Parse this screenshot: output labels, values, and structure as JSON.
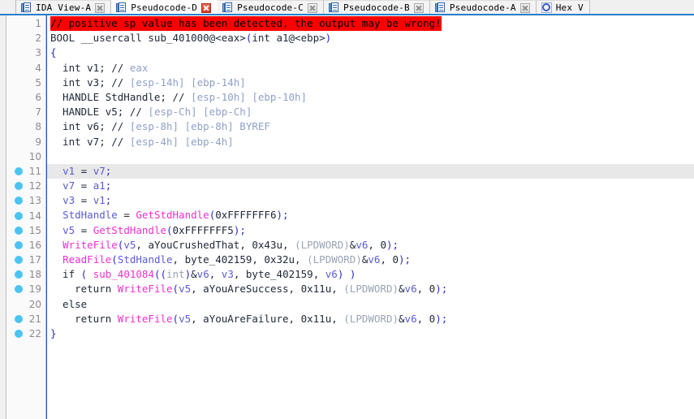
{
  "window": {
    "accent_color": "#2a7fc9",
    "breakpoint_color": "#4cc3f0",
    "warning_bg_color": "#ff0000"
  },
  "tabs": [
    {
      "label": "IDA View-A",
      "icon": "document-icon",
      "active": false,
      "close_icon": "close-icon",
      "close_style": "grey"
    },
    {
      "label": "Pseudocode-D",
      "icon": "document-icon",
      "active": true,
      "close_icon": "close-icon-red",
      "close_style": "red"
    },
    {
      "label": "Pseudocode-C",
      "icon": "document-icon",
      "active": false,
      "close_icon": "close-icon",
      "close_style": "grey"
    },
    {
      "label": "Pseudocode-B",
      "icon": "document-icon",
      "active": false,
      "close_icon": "close-icon",
      "close_style": "grey"
    },
    {
      "label": "Pseudocode-A",
      "icon": "document-icon",
      "active": false,
      "close_icon": "close-icon",
      "close_style": "grey"
    },
    {
      "label": "Hex V",
      "icon": "hex-view-icon",
      "active": false,
      "close_icon": "",
      "close_style": "none"
    }
  ],
  "editor": {
    "current_line": 11,
    "lines": [
      {
        "number": "1",
        "breakpoint": false,
        "current": false,
        "tokens": [
          {
            "text": "// positive sp value has been detected, the output may be wrong!",
            "cls": "t-warn"
          }
        ]
      },
      {
        "number": "2",
        "breakpoint": false,
        "current": false,
        "tokens": [
          {
            "text": "BOOL __usercall sub_401000@<eax>",
            "cls": "t-plain"
          },
          {
            "text": "(",
            "cls": "t-punct"
          },
          {
            "text": "int a1@<ebp>",
            "cls": "t-plain"
          },
          {
            "text": ")",
            "cls": "t-punct"
          }
        ]
      },
      {
        "number": "3",
        "breakpoint": false,
        "current": false,
        "tokens": [
          {
            "text": "{",
            "cls": "t-punct"
          }
        ]
      },
      {
        "number": "4",
        "breakpoint": false,
        "current": false,
        "tokens": [
          {
            "text": "  int v1; ",
            "cls": "t-plain"
          },
          {
            "text": "// ",
            "cls": "t-cmt-dk"
          },
          {
            "text": "eax",
            "cls": "t-cmt"
          }
        ]
      },
      {
        "number": "5",
        "breakpoint": false,
        "current": false,
        "tokens": [
          {
            "text": "  int v3; ",
            "cls": "t-plain"
          },
          {
            "text": "// ",
            "cls": "t-cmt-dk"
          },
          {
            "text": "[esp-14h] [ebp-14h]",
            "cls": "t-cmt"
          }
        ]
      },
      {
        "number": "6",
        "breakpoint": false,
        "current": false,
        "tokens": [
          {
            "text": "  HANDLE StdHandle; ",
            "cls": "t-plain"
          },
          {
            "text": "// ",
            "cls": "t-cmt-dk"
          },
          {
            "text": "[esp-10h] [ebp-10h]",
            "cls": "t-cmt"
          }
        ]
      },
      {
        "number": "7",
        "breakpoint": false,
        "current": false,
        "tokens": [
          {
            "text": "  HANDLE v5; ",
            "cls": "t-plain"
          },
          {
            "text": "// ",
            "cls": "t-cmt-dk"
          },
          {
            "text": "[esp-Ch] [ebp-Ch]",
            "cls": "t-cmt"
          }
        ]
      },
      {
        "number": "8",
        "breakpoint": false,
        "current": false,
        "tokens": [
          {
            "text": "  int v6; ",
            "cls": "t-plain"
          },
          {
            "text": "// ",
            "cls": "t-cmt-dk"
          },
          {
            "text": "[esp-8h] [ebp-8h] BYREF",
            "cls": "t-cmt"
          }
        ]
      },
      {
        "number": "9",
        "breakpoint": false,
        "current": false,
        "tokens": [
          {
            "text": "  int v7; ",
            "cls": "t-plain"
          },
          {
            "text": "// ",
            "cls": "t-cmt-dk"
          },
          {
            "text": "[esp-4h] [ebp-4h]",
            "cls": "t-cmt"
          }
        ]
      },
      {
        "number": "10",
        "breakpoint": false,
        "current": false,
        "tokens": []
      },
      {
        "number": "11",
        "breakpoint": true,
        "current": true,
        "tokens": [
          {
            "text": "  ",
            "cls": "t-plain"
          },
          {
            "text": "v1",
            "cls": "t-var"
          },
          {
            "text": " = ",
            "cls": "t-plain"
          },
          {
            "text": "v7",
            "cls": "t-var"
          },
          {
            "text": ";",
            "cls": "t-punct"
          }
        ]
      },
      {
        "number": "12",
        "breakpoint": true,
        "current": false,
        "tokens": [
          {
            "text": "  ",
            "cls": "t-plain"
          },
          {
            "text": "v7",
            "cls": "t-var"
          },
          {
            "text": " = ",
            "cls": "t-plain"
          },
          {
            "text": "a1",
            "cls": "t-var"
          },
          {
            "text": ";",
            "cls": "t-punct"
          }
        ]
      },
      {
        "number": "13",
        "breakpoint": true,
        "current": false,
        "tokens": [
          {
            "text": "  ",
            "cls": "t-plain"
          },
          {
            "text": "v3",
            "cls": "t-var"
          },
          {
            "text": " = ",
            "cls": "t-plain"
          },
          {
            "text": "v1",
            "cls": "t-var"
          },
          {
            "text": ";",
            "cls": "t-punct"
          }
        ]
      },
      {
        "number": "14",
        "breakpoint": true,
        "current": false,
        "tokens": [
          {
            "text": "  ",
            "cls": "t-plain"
          },
          {
            "text": "StdHandle",
            "cls": "t-var"
          },
          {
            "text": " = ",
            "cls": "t-plain"
          },
          {
            "text": "GetStdHandle",
            "cls": "t-fn"
          },
          {
            "text": "(",
            "cls": "t-punct"
          },
          {
            "text": "0xFFFFFFF6",
            "cls": "t-num"
          },
          {
            "text": ");",
            "cls": "t-punct"
          }
        ]
      },
      {
        "number": "15",
        "breakpoint": true,
        "current": false,
        "tokens": [
          {
            "text": "  ",
            "cls": "t-plain"
          },
          {
            "text": "v5",
            "cls": "t-var"
          },
          {
            "text": " = ",
            "cls": "t-plain"
          },
          {
            "text": "GetStdHandle",
            "cls": "t-fn"
          },
          {
            "text": "(",
            "cls": "t-punct"
          },
          {
            "text": "0xFFFFFFF5",
            "cls": "t-num"
          },
          {
            "text": ");",
            "cls": "t-punct"
          }
        ]
      },
      {
        "number": "16",
        "breakpoint": true,
        "current": false,
        "tokens": [
          {
            "text": "  ",
            "cls": "t-plain"
          },
          {
            "text": "WriteFile",
            "cls": "t-fn"
          },
          {
            "text": "(",
            "cls": "t-punct"
          },
          {
            "text": "v5",
            "cls": "t-var"
          },
          {
            "text": ", aYouCrushedThat, 0x43u, ",
            "cls": "t-plain"
          },
          {
            "text": "(LPDWORD)",
            "cls": "t-cast"
          },
          {
            "text": "&",
            "cls": "t-plain"
          },
          {
            "text": "v6",
            "cls": "t-var"
          },
          {
            "text": ", 0",
            "cls": "t-plain"
          },
          {
            "text": ");",
            "cls": "t-punct"
          }
        ]
      },
      {
        "number": "17",
        "breakpoint": true,
        "current": false,
        "tokens": [
          {
            "text": "  ",
            "cls": "t-plain"
          },
          {
            "text": "ReadFile",
            "cls": "t-fn"
          },
          {
            "text": "(",
            "cls": "t-punct"
          },
          {
            "text": "StdHandle",
            "cls": "t-var"
          },
          {
            "text": ", byte_402159, 0x32u, ",
            "cls": "t-plain"
          },
          {
            "text": "(LPDWORD)",
            "cls": "t-cast"
          },
          {
            "text": "&",
            "cls": "t-plain"
          },
          {
            "text": "v6",
            "cls": "t-var"
          },
          {
            "text": ", 0",
            "cls": "t-plain"
          },
          {
            "text": ");",
            "cls": "t-punct"
          }
        ]
      },
      {
        "number": "18",
        "breakpoint": true,
        "current": false,
        "tokens": [
          {
            "text": "  if ",
            "cls": "t-plain"
          },
          {
            "text": "(",
            "cls": "t-punct"
          },
          {
            "text": " ",
            "cls": "t-plain"
          },
          {
            "text": "sub_401084",
            "cls": "t-fn"
          },
          {
            "text": "((",
            "cls": "t-punct"
          },
          {
            "text": "int",
            "cls": "t-cast"
          },
          {
            "text": ")",
            "cls": "t-punct"
          },
          {
            "text": "&",
            "cls": "t-plain"
          },
          {
            "text": "v6",
            "cls": "t-var"
          },
          {
            "text": ", ",
            "cls": "t-plain"
          },
          {
            "text": "v3",
            "cls": "t-var"
          },
          {
            "text": ", byte_402159, ",
            "cls": "t-plain"
          },
          {
            "text": "v6",
            "cls": "t-var"
          },
          {
            "text": ") )",
            "cls": "t-punct"
          }
        ]
      },
      {
        "number": "19",
        "breakpoint": true,
        "current": false,
        "tokens": [
          {
            "text": "    return ",
            "cls": "t-plain"
          },
          {
            "text": "WriteFile",
            "cls": "t-fn"
          },
          {
            "text": "(",
            "cls": "t-punct"
          },
          {
            "text": "v5",
            "cls": "t-var"
          },
          {
            "text": ", aYouAreSuccess, 0x11u, ",
            "cls": "t-plain"
          },
          {
            "text": "(LPDWORD)",
            "cls": "t-cast"
          },
          {
            "text": "&",
            "cls": "t-plain"
          },
          {
            "text": "v6",
            "cls": "t-var"
          },
          {
            "text": ", 0",
            "cls": "t-plain"
          },
          {
            "text": ");",
            "cls": "t-punct"
          }
        ]
      },
      {
        "number": "20",
        "breakpoint": false,
        "current": false,
        "tokens": [
          {
            "text": "  else",
            "cls": "t-plain"
          }
        ]
      },
      {
        "number": "21",
        "breakpoint": true,
        "current": false,
        "tokens": [
          {
            "text": "    return ",
            "cls": "t-plain"
          },
          {
            "text": "WriteFile",
            "cls": "t-fn"
          },
          {
            "text": "(",
            "cls": "t-punct"
          },
          {
            "text": "v5",
            "cls": "t-var"
          },
          {
            "text": ", aYouAreFailure, 0x11u, ",
            "cls": "t-plain"
          },
          {
            "text": "(LPDWORD)",
            "cls": "t-cast"
          },
          {
            "text": "&",
            "cls": "t-plain"
          },
          {
            "text": "v6",
            "cls": "t-var"
          },
          {
            "text": ", 0",
            "cls": "t-plain"
          },
          {
            "text": ");",
            "cls": "t-punct"
          }
        ]
      },
      {
        "number": "22",
        "breakpoint": true,
        "current": false,
        "tokens": [
          {
            "text": "}",
            "cls": "t-punct"
          }
        ]
      }
    ]
  }
}
